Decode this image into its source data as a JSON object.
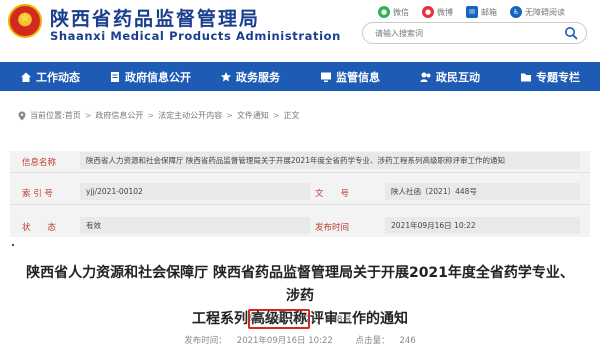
{
  "header": {
    "title": "陕西省药品监督管理局",
    "title_en": "Shaanxi Medical Products Administration",
    "toplinks": [
      {
        "label": "微信",
        "icon": "wechat-icon"
      },
      {
        "label": "微博",
        "icon": "weibo-icon"
      },
      {
        "label": "邮箱",
        "icon": "mail-icon"
      },
      {
        "label": "无障碍阅读",
        "icon": "accessibility-icon"
      }
    ],
    "search": {
      "placeholder": "请输入搜索词"
    }
  },
  "nav": {
    "items": [
      {
        "label": "工作动态",
        "icon": "home-icon"
      },
      {
        "label": "政府信息公开",
        "icon": "document-icon"
      },
      {
        "label": "政务服务",
        "icon": "service-icon"
      },
      {
        "label": "监管信息",
        "icon": "monitor-icon"
      },
      {
        "label": "政民互动",
        "icon": "chat-icon"
      },
      {
        "label": "专题专栏",
        "icon": "folder-icon"
      }
    ],
    "background": "#1e5bb5"
  },
  "breadcrumb": {
    "prefix": "当前位置:",
    "items": [
      "首页",
      "政府信息公开",
      "法定主动公开内容",
      "文件通知",
      "正文"
    ]
  },
  "info": {
    "index_label": "信息名称",
    "index_value": "陕西省人力资源和社会保障厅 陕西省药品监督管理局关于开展2021年度全省药学专业、涉药工程系列高级职称评审工作的通知",
    "number_label": "索 引 号",
    "number_value": "yjj/2021-00102",
    "doc_label": "文　　号",
    "doc_value": "陕人社函〔2021〕448号",
    "status_label": "状　　态",
    "status_value": "有效",
    "date_label": "发布时间",
    "date_value": "2021年09月16日 10:22"
  },
  "article": {
    "title_part1": "陕西省人力资源和社会保障厅 陕西省药品监督管理局关于开展2021年度全省药学专业、涉药",
    "title_part2": "工程系列",
    "title_highlight": "高级职称",
    "title_part3": "评审工作的通知",
    "doc_no": "陕人社函〔2021〕448号",
    "publish_label": "发布时间：",
    "publish_time": "2021年09月16日 10:22",
    "views_label": "点击量：",
    "views": "246"
  },
  "colors": {
    "brand": "#1a3f8f",
    "accent_red": "#c0392b",
    "highlight_border": "#d9261c"
  }
}
